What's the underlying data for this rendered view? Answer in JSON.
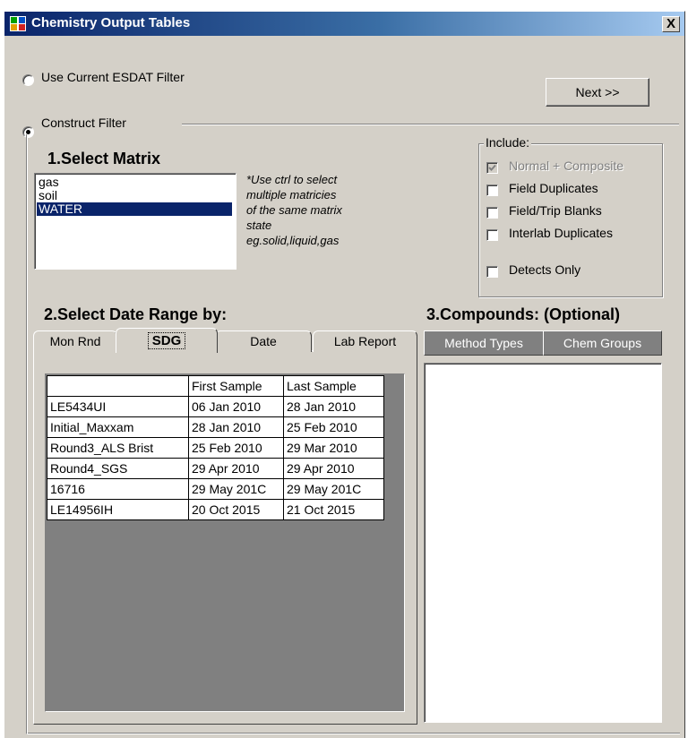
{
  "window": {
    "title": "Chemistry Output Tables",
    "close_label": "X"
  },
  "filter": {
    "option_current": "Use Current ESDAT Filter",
    "option_construct": "Construct Filter",
    "selected": "construct"
  },
  "next_button": "Next >>",
  "matrix": {
    "heading": "1.Select Matrix",
    "items": [
      "gas",
      "soil",
      "WATER"
    ],
    "selected": "WATER",
    "note_lines": [
      "*Use ctrl to select",
      "multiple matricies",
      "of the same matrix",
      "state",
      "eg.solid,liquid,gas"
    ]
  },
  "include": {
    "legend": "Include:",
    "options": [
      {
        "label": "Normal + Composite",
        "checked": true,
        "disabled": true
      },
      {
        "label": "Field Duplicates",
        "checked": false,
        "disabled": false
      },
      {
        "label": "Field/Trip Blanks",
        "checked": false,
        "disabled": false
      },
      {
        "label": "Interlab Duplicates",
        "checked": false,
        "disabled": false
      },
      {
        "label": "Detects Only",
        "checked": false,
        "disabled": false
      }
    ]
  },
  "date_range": {
    "heading": "2.Select Date Range by:",
    "tabs": [
      "Mon Rnd",
      "SDG",
      "Date",
      "Lab Report"
    ],
    "active_tab": "SDG",
    "table": {
      "headers": [
        "",
        "First Sample",
        "Last Sample"
      ],
      "rows": [
        [
          "LE5434UI",
          "06 Jan 2010",
          "28 Jan 2010"
        ],
        [
          "Initial_Maxxam",
          "28 Jan 2010",
          "25 Feb 2010"
        ],
        [
          "Round3_ALS Brist",
          "25 Feb 2010",
          "29 Mar 2010"
        ],
        [
          "Round4_SGS",
          "29 Apr 2010",
          "29 Apr 2010"
        ],
        [
          "16716",
          "29 May 201C",
          "29 May 201C"
        ],
        [
          "LE14956IH",
          "20 Oct 2015",
          "21 Oct 2015"
        ]
      ]
    }
  },
  "compounds": {
    "heading": "3.Compounds: (Optional)",
    "buttons": [
      "Method Types",
      "Chem Groups"
    ]
  },
  "colors": {
    "face": "#d4d0c8",
    "title_start": "#0a246a",
    "title_end": "#a6caf0",
    "selection": "#0a246a"
  }
}
